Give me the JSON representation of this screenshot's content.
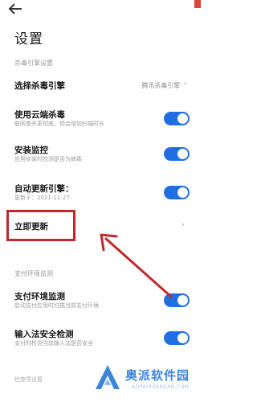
{
  "header": {
    "title": "设置"
  },
  "sections": {
    "antivirus_header": "杀毒引擎设置",
    "payment_header": "支付环境监测",
    "bottom_header": "检查项设置"
  },
  "rows": {
    "engine": {
      "title": "选择杀毒引擎",
      "value": "腾讯杀毒引擎"
    },
    "cloud": {
      "title": "使用云端杀毒",
      "subtitle": "联网查杀更彻底，但会增加扫描时长",
      "enabled": true
    },
    "install": {
      "title": "安装监控",
      "subtitle": "应用安装时检测是否为病毒",
      "enabled": true
    },
    "auto_update": {
      "title": "自动更新引擎：",
      "subtitle": "更新于：2021-11-27",
      "enabled": true
    },
    "update_now": {
      "title": "立即更新"
    },
    "payment": {
      "title": "支付环境监测",
      "subtitle": "启动支付应用时扫描当前支付环境",
      "enabled": true
    },
    "ime": {
      "title": "输入法安全检测",
      "subtitle": "支付时检测当前输入法是否安全",
      "enabled": true
    }
  },
  "watermark": {
    "name": "奥派软件园",
    "url": "AOPAIRUANJIAN.COM"
  },
  "colors": {
    "accent": "#1f6fe3",
    "annotation": "#c0282a"
  }
}
